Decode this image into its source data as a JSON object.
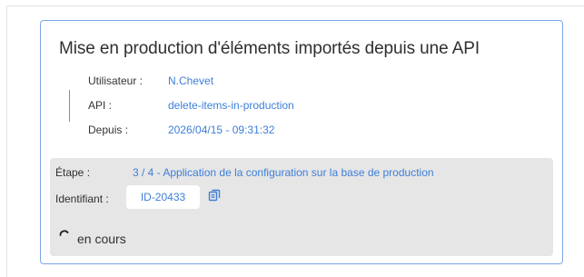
{
  "job": {
    "title": "Mise en production d'éléments importés depuis une API",
    "meta": {
      "user_label": "Utilisateur :",
      "user_value": "N.Chevet",
      "api_label": "API :",
      "api_value": "delete-items-in-production",
      "since_label": "Depuis :",
      "since_value": "2026/04/15 - 09:31:32"
    },
    "status": {
      "step_label": "Étape :",
      "step_value": "3 / 4 - Application de la configuration sur la base de production",
      "id_label": "Identifiant :",
      "id_value": "ID-20433",
      "state_text": "en cours"
    }
  },
  "colors": {
    "accent": "#3d7fd9",
    "card_border": "#7aa6e6",
    "status_bg": "#e6e6e6"
  },
  "icons": {
    "copy": "copy-icon",
    "spinner": "loading-spinner-icon"
  }
}
